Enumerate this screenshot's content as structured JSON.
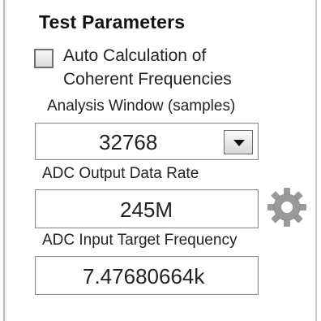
{
  "panel": {
    "title": "Test Parameters",
    "auto_calc": {
      "checked": false,
      "label_line1": "Auto Calculation of",
      "label_line2": "Coherent Frequencies"
    },
    "analysis_window": {
      "label": "Analysis Window (samples)",
      "value": "32768"
    },
    "adc_output_rate": {
      "label": "ADC Output Data Rate",
      "value": "245M"
    },
    "adc_input_target": {
      "label": "ADC Input Target Frequency",
      "value": "7.47680664k"
    },
    "icons": {
      "dropdown": "chevron-down-icon",
      "settings": "gear-icon"
    },
    "colors": {
      "gear": "#9a9a9a",
      "border": "#8a8a8a"
    }
  }
}
